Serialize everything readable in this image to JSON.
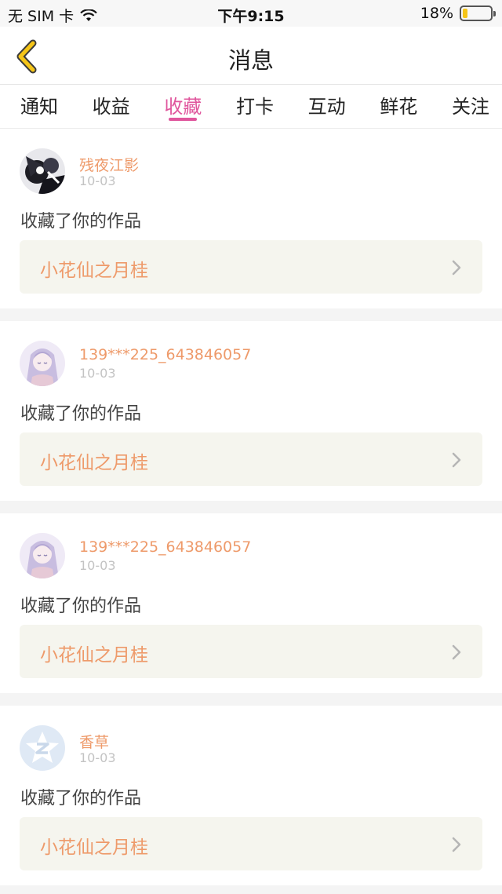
{
  "status_bar": {
    "carrier": "无 SIM 卡",
    "time": "下午9:15",
    "battery": "18%",
    "battery_level": 0.18
  },
  "nav": {
    "title": "消息"
  },
  "tabs": [
    {
      "label": "通知",
      "active": false
    },
    {
      "label": "收益",
      "active": false
    },
    {
      "label": "收藏",
      "active": true
    },
    {
      "label": "打卡",
      "active": false
    },
    {
      "label": "互动",
      "active": false
    },
    {
      "label": "鲜花",
      "active": false
    },
    {
      "label": "关注",
      "active": false
    }
  ],
  "items": [
    {
      "username": "残夜江影",
      "date": "10-03",
      "action": "收藏了你的作品",
      "work": "小花仙之月桂",
      "avatar": "dark-anime"
    },
    {
      "username": "139***225_643846057",
      "date": "10-03",
      "action": "收藏了你的作品",
      "work": "小花仙之月桂",
      "avatar": "purple-anime"
    },
    {
      "username": "139***225_643846057",
      "date": "10-03",
      "action": "收藏了你的作品",
      "work": "小花仙之月桂",
      "avatar": "purple-anime"
    },
    {
      "username": "香草",
      "date": "10-03",
      "action": "收藏了你的作品",
      "work": "小花仙之月桂",
      "avatar": "qzone-default"
    }
  ],
  "colors": {
    "accent": "#e0569d",
    "username": "#ee9a6a",
    "back_arrow": "#f5c518"
  }
}
